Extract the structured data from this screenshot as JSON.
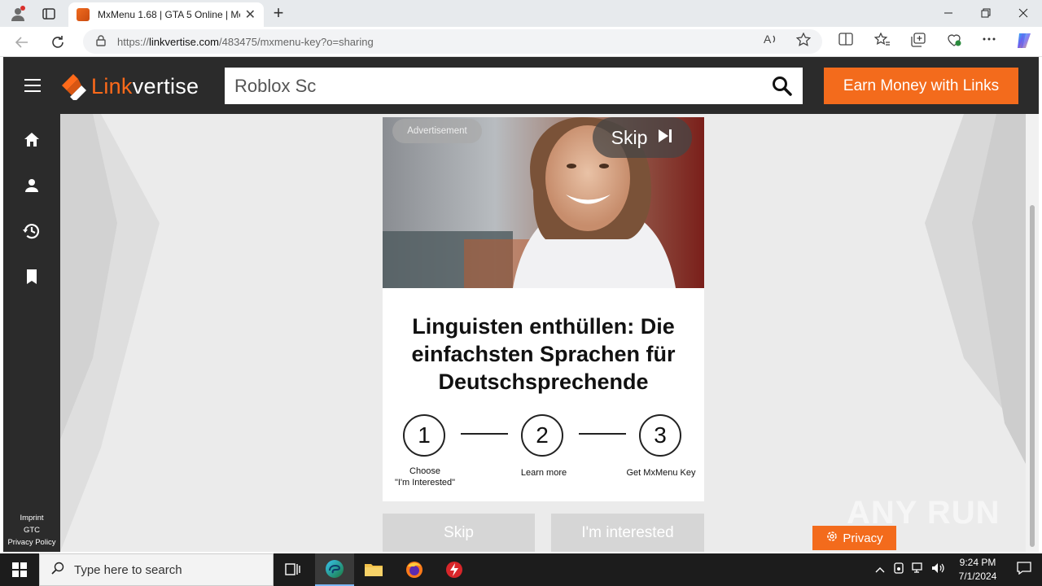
{
  "browser": {
    "tab_title": "MxMenu 1.68 | GTA 5 Online | Mo",
    "url_prefix": "https://",
    "url_host": "linkvertise.com",
    "url_path": "/483475/mxmenu-key?o=sharing",
    "new_tab_label": "+",
    "tab_close_label": "✕"
  },
  "site": {
    "logo_link": "Link",
    "logo_rest": "vertise",
    "search_value": "Roblox Sc",
    "earn_button": "Earn Money with Links",
    "footer_links": [
      "Imprint",
      "GTC",
      "Privacy Policy"
    ],
    "privacy_button": "Privacy"
  },
  "ad": {
    "label": "Advertisement",
    "skip_label": "Skip",
    "headline": "Linguisten enthüllen: Die einfachsten Sprachen für Deutschsprechende",
    "steps": [
      {
        "number": "1",
        "label": "Choose\n\"I'm Interested\""
      },
      {
        "number": "2",
        "label": "Learn more"
      },
      {
        "number": "3",
        "label": "Get MxMenu Key"
      }
    ],
    "skip_button": "Skip",
    "interested_button": "I'm interested"
  },
  "watermark": "ANY RUN",
  "taskbar": {
    "search_placeholder": "Type here to search",
    "time": "9:24 PM",
    "date": "7/1/2024"
  },
  "colors": {
    "brand_orange": "#f36b1c",
    "header_dark": "#2b2b2b",
    "page_bg": "#ebebeb"
  }
}
